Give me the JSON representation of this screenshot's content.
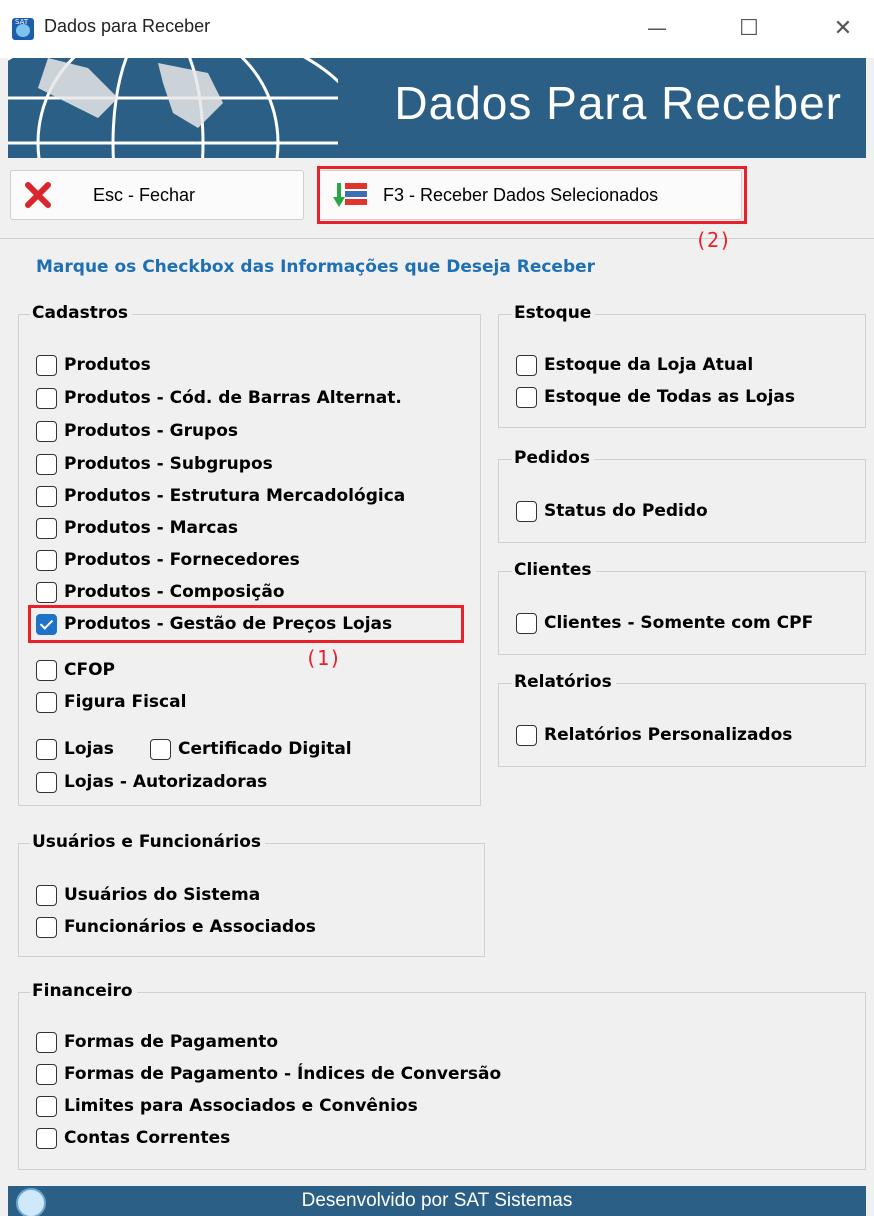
{
  "window": {
    "title": "Dados para Receber",
    "minimize_glyph": "—",
    "maximize_glyph": "☐",
    "close_glyph": "✕"
  },
  "banner": {
    "title": "Dados Para Receber"
  },
  "toolbar": {
    "close_label": "Esc - Fechar",
    "close_icon": "red-x-icon",
    "receive_label": "F3 - Receber Dados Selecionados",
    "receive_icon": "receive-data-icon"
  },
  "annotations": {
    "marker1": "(1)",
    "marker2": "(2)",
    "color": "#e8202a"
  },
  "instruction": "Marque os Checkbox das Informações que Deseja Receber",
  "groups": {
    "cadastros": {
      "title": "Cadastros",
      "items": [
        {
          "label": "Produtos",
          "checked": false
        },
        {
          "label": "Produtos - Cód. de Barras Alternat.",
          "checked": false
        },
        {
          "label": "Produtos - Grupos",
          "checked": false
        },
        {
          "label": "Produtos - Subgrupos",
          "checked": false
        },
        {
          "label": "Produtos - Estrutura Mercadológica",
          "checked": false
        },
        {
          "label": "Produtos - Marcas",
          "checked": false
        },
        {
          "label": "Produtos - Fornecedores",
          "checked": false
        },
        {
          "label": "Produtos - Composição",
          "checked": false
        },
        {
          "label": "Produtos - Gestão de Preços Lojas",
          "checked": true
        },
        {
          "label": "CFOP",
          "checked": false
        },
        {
          "label": "Figura Fiscal",
          "checked": false
        },
        {
          "label": "Lojas",
          "checked": false
        },
        {
          "label": "Certificado Digital",
          "checked": false
        },
        {
          "label": "Lojas - Autorizadoras",
          "checked": false
        }
      ]
    },
    "estoque": {
      "title": "Estoque",
      "items": [
        {
          "label": "Estoque da Loja Atual",
          "checked": false
        },
        {
          "label": "Estoque de Todas as Lojas",
          "checked": false
        }
      ]
    },
    "pedidos": {
      "title": "Pedidos",
      "items": [
        {
          "label": "Status do Pedido",
          "checked": false
        }
      ]
    },
    "clientes": {
      "title": "Clientes",
      "items": [
        {
          "label": "Clientes - Somente com CPF",
          "checked": false
        }
      ]
    },
    "relatorios": {
      "title": "Relatórios",
      "items": [
        {
          "label": "Relatórios Personalizados",
          "checked": false
        }
      ]
    },
    "usuarios": {
      "title": "Usuários e Funcionários",
      "items": [
        {
          "label": "Usuários do Sistema",
          "checked": false
        },
        {
          "label": "Funcionários e Associados",
          "checked": false
        }
      ]
    },
    "financeiro": {
      "title": "Financeiro",
      "items": [
        {
          "label": "Formas de Pagamento",
          "checked": false
        },
        {
          "label": "Formas de Pagamento - Índices de Conversão",
          "checked": false
        },
        {
          "label": "Limites para Associados e Convênios",
          "checked": false
        },
        {
          "label": "Contas Correntes",
          "checked": false
        }
      ]
    }
  },
  "footer": {
    "text": "Desenvolvido por SAT Sistemas",
    "icon": "globe-icon"
  },
  "colors": {
    "banner": "#2b5f86",
    "instruction": "#1e6fb3",
    "checkbox_checked": "#1e73c8"
  }
}
